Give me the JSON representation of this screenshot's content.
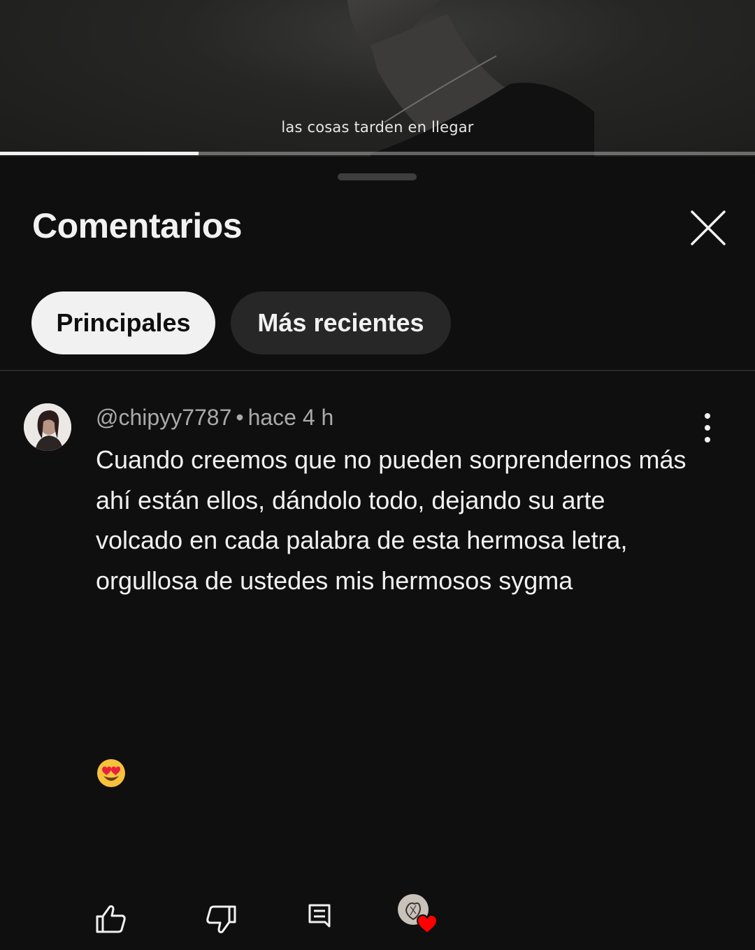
{
  "video": {
    "subtitle": "las cosas tarden en llegar",
    "progress_fraction": 0.263
  },
  "sheet": {
    "title": "Comentarios",
    "close_icon": "close-icon"
  },
  "chips": [
    {
      "label": "Principales",
      "selected": true
    },
    {
      "label": "Más recientes",
      "selected": false
    }
  ],
  "comment": {
    "author": "@chipyy7787",
    "separator": "•",
    "time": "hace 4 h",
    "text": "Cuando creemos que no pueden sorprendernos más ahí están ellos, dándolo todo, dejando su arte volcado en cada palabra de esta hermosa letra, orgullosa de ustedes mis hermosos sygma",
    "emoji": "heart-eyes-emoji",
    "actions": {
      "like_icon": "thumb-up-icon",
      "dislike_icon": "thumb-down-icon",
      "reply_icon": "reply-icon",
      "creator_heart_icon": "creator-heart-icon"
    }
  },
  "colors": {
    "background": "#0f0f0f",
    "chip_active": "#f1f1f1",
    "chip_inactive": "#272727",
    "meta_text": "#aaaaaa",
    "heart": "#ff0000"
  }
}
